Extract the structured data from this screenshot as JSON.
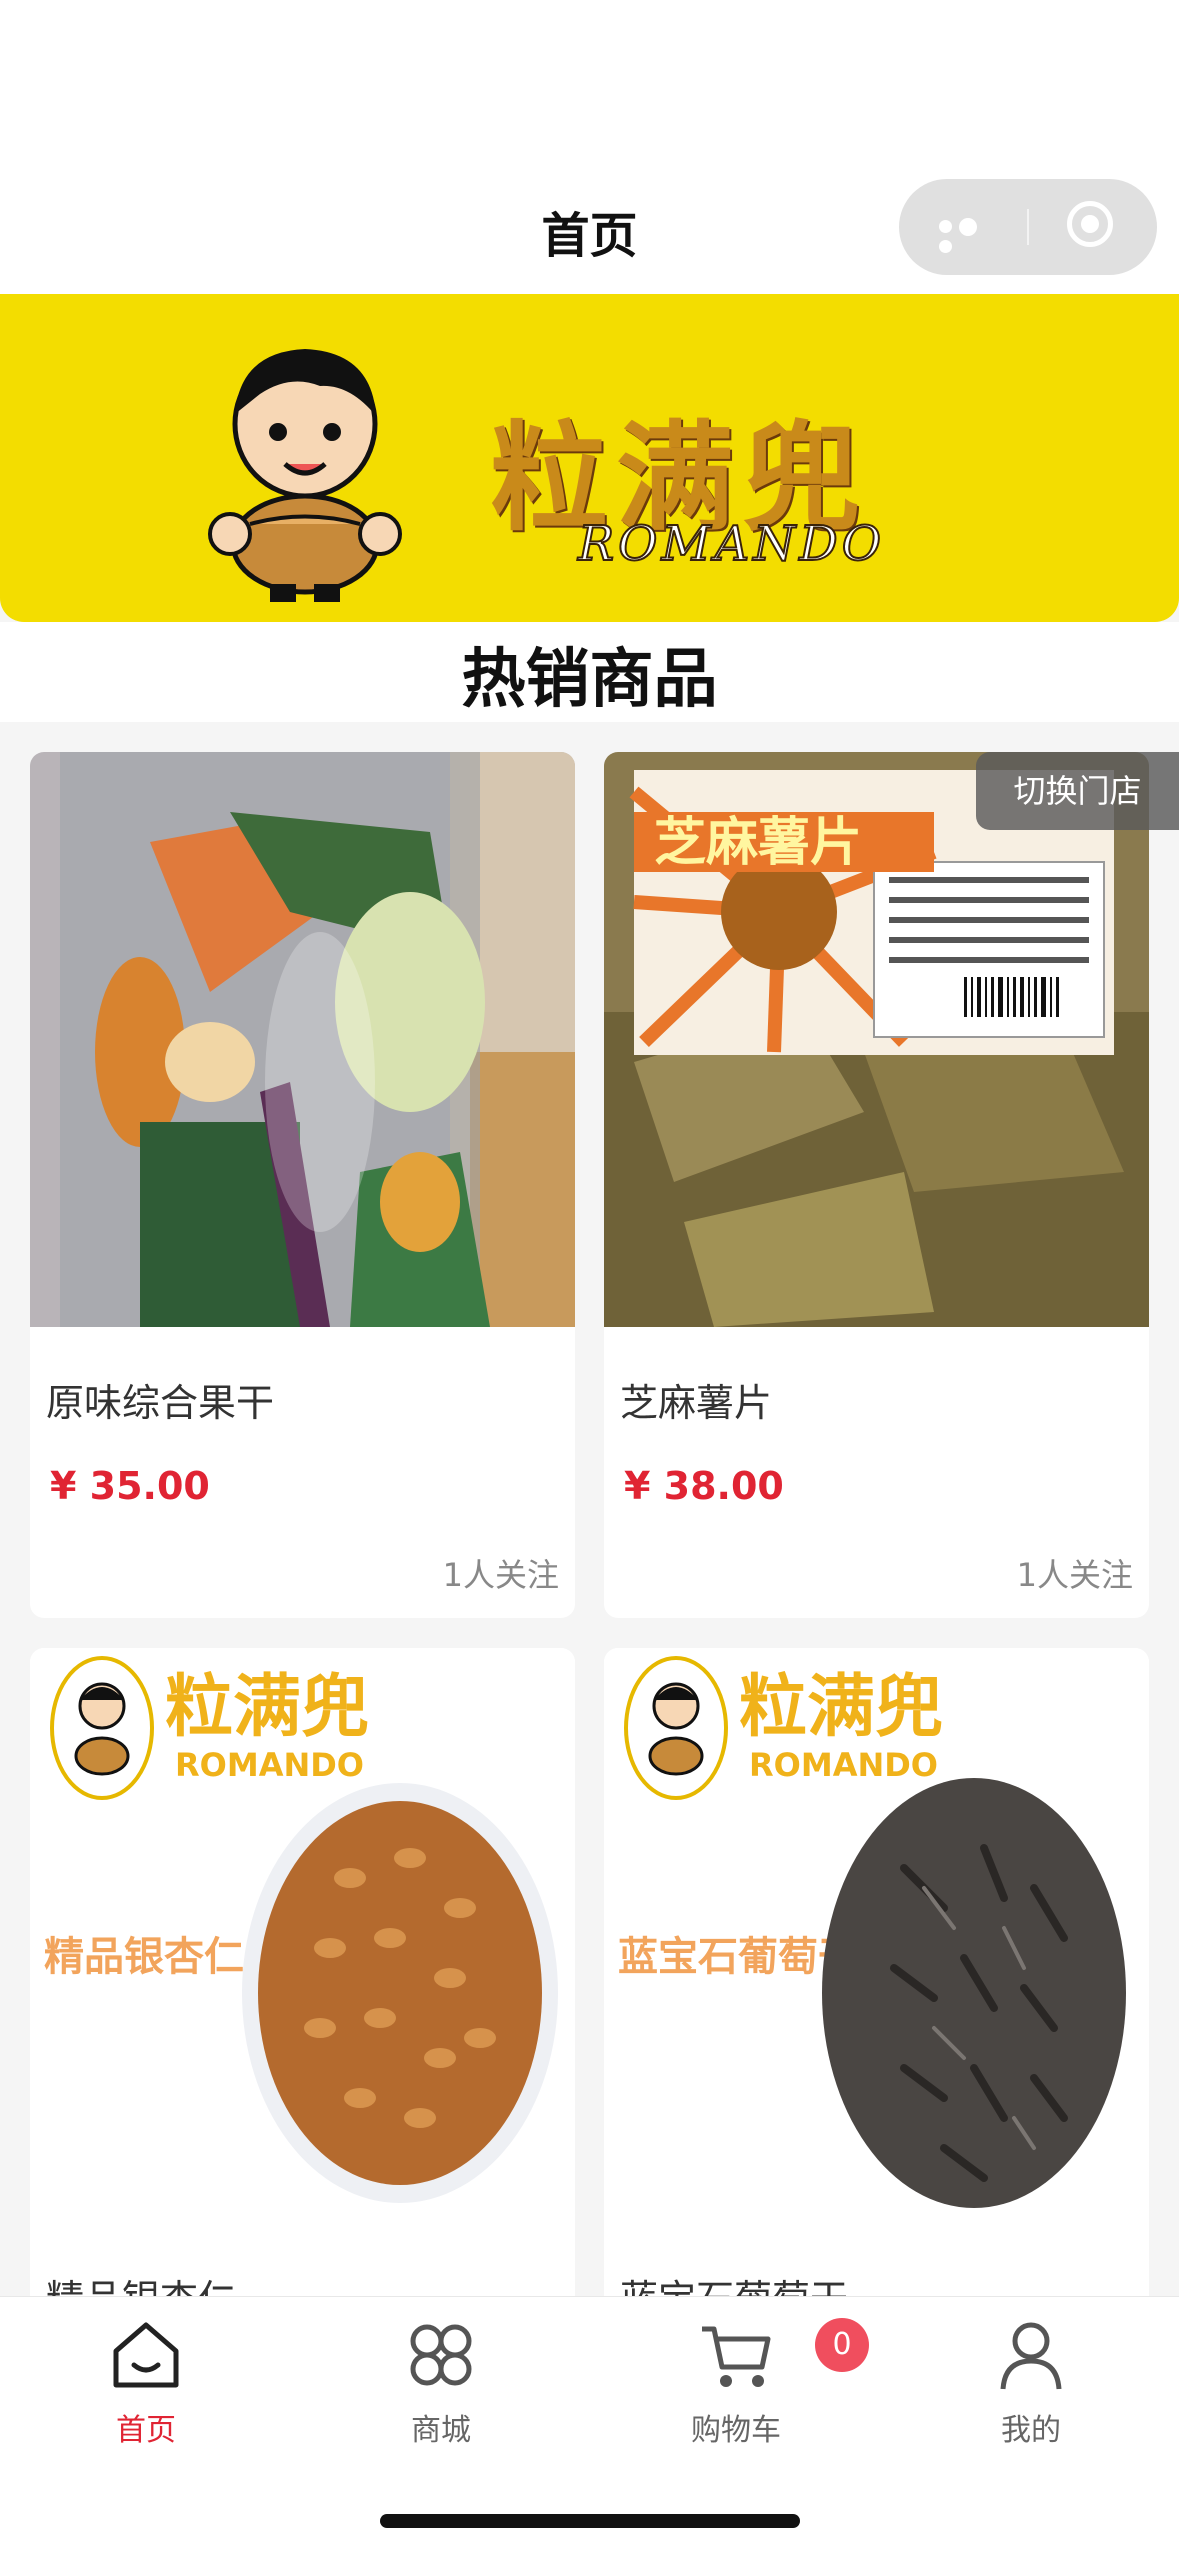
{
  "header": {
    "title": "首页"
  },
  "banner": {
    "brand_name": "粒满兜",
    "brand_latin": "ROMANDO"
  },
  "section": {
    "title": "热销商品"
  },
  "switch_store": {
    "label": "切换门店"
  },
  "products": [
    {
      "name": "原味综合果干",
      "price": "¥ 35.00",
      "followers": "1人关注"
    },
    {
      "name": "芝麻薯片",
      "price": "¥ 38.00",
      "followers": "1人关注",
      "package_text": "芝麻薯片"
    },
    {
      "name": "精品银杏仁",
      "image_brand": "粒满兜",
      "image_latin": "ROMANDO",
      "image_caption": "精品银杏仁"
    },
    {
      "name": "蓝宝石葡萄干",
      "image_brand": "粒满兜",
      "image_latin": "ROMANDO",
      "image_caption": "蓝宝石葡萄干"
    }
  ],
  "tabbar": {
    "items": [
      {
        "label": "首页",
        "icon": "home-icon",
        "active": true
      },
      {
        "label": "商城",
        "icon": "grid-icon",
        "active": false
      },
      {
        "label": "购物车",
        "icon": "cart-icon",
        "active": false
      },
      {
        "label": "我的",
        "icon": "user-icon",
        "active": false
      }
    ],
    "cart_badge": "0"
  },
  "colors": {
    "accent": "#e02433",
    "banner": "#f3dd00",
    "badge": "#f04e5e"
  }
}
